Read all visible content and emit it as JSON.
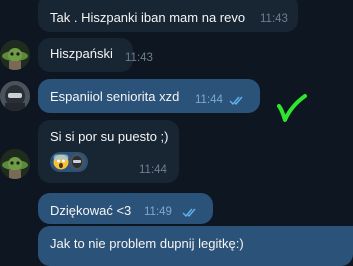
{
  "messages": [
    {
      "text": "Tak . Hiszpanki iban mam na revo",
      "time": "11:43"
    },
    {
      "text": "Hiszpański",
      "time": "11:43"
    },
    {
      "text": "Espaniiol seniorita xzd",
      "time": "11:44"
    },
    {
      "text": "Si si por su puesto ;)",
      "time": "11:44"
    },
    {
      "text": "Dziękować <3",
      "time": "11:49"
    },
    {
      "text": "Jak to nie problem dupnij legitkę:)"
    }
  ],
  "reaction": {
    "emoji": "scream-emoji"
  },
  "annotation": {
    "color": "#2ee62e"
  },
  "colors": {
    "background": "#0e1621",
    "incoming_bubble": "#182533",
    "outgoing_bubble": "#2b5278",
    "read_ticks": "#5fb1ef"
  }
}
